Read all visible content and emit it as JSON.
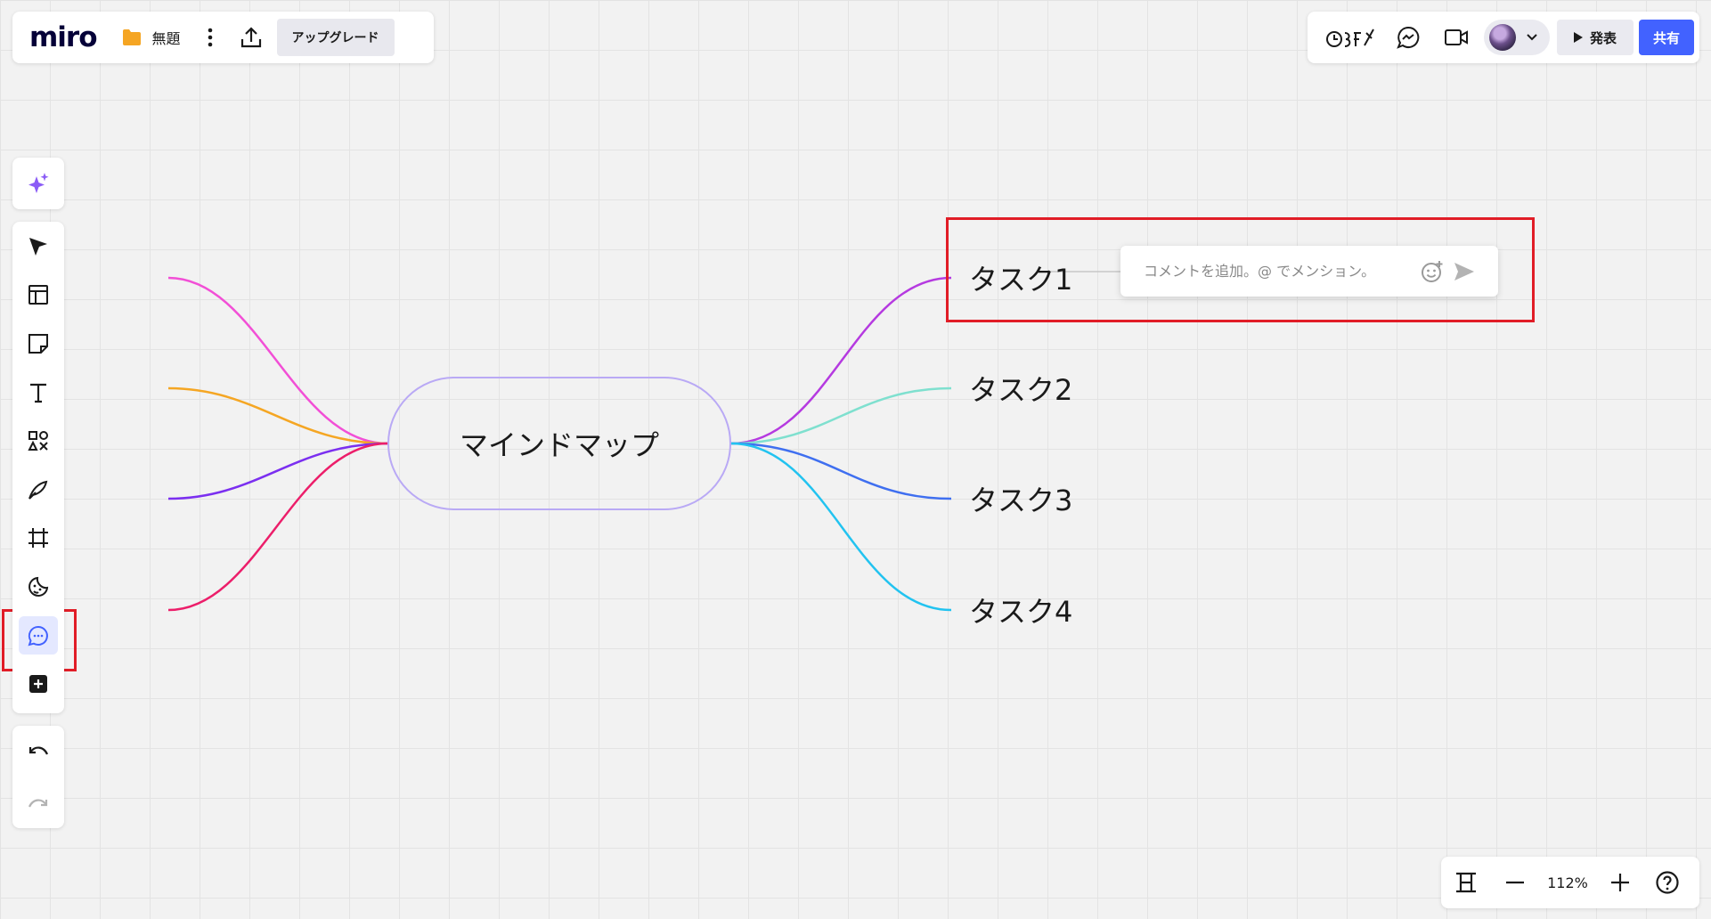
{
  "header": {
    "logo_text": "miro",
    "board_title": "無題",
    "upgrade_label": "アップグレード",
    "present_label": "発表",
    "share_label": "共有"
  },
  "toolbar": {
    "ai_icon": "sparkle-icon",
    "tools": [
      "cursor-icon",
      "template-icon",
      "sticky-note-icon",
      "text-icon",
      "shapes-icon",
      "pen-icon",
      "frame-icon",
      "sticker-icon",
      "comment-icon",
      "more-tools-icon"
    ],
    "active_tool": "comment",
    "history": [
      "undo-icon",
      "redo-icon"
    ]
  },
  "mindmap": {
    "root": "マインドマップ",
    "tasks": [
      "タスク1",
      "タスク2",
      "タスク3",
      "タスク4"
    ],
    "colors": {
      "root_border": "#b9a9f5",
      "right": [
        "#b53ae0",
        "#7fe0cf",
        "#3f6ff0",
        "#22c3f0"
      ],
      "left": [
        "#f24fd6",
        "#f5a623",
        "#7b2ff0",
        "#ec1e6a"
      ]
    }
  },
  "comment": {
    "placeholder": "コメントを追加。@ でメンション。"
  },
  "zoom": {
    "level": "112%"
  },
  "colors": {
    "accent": "#4262ff",
    "highlight": "#e11d27"
  }
}
